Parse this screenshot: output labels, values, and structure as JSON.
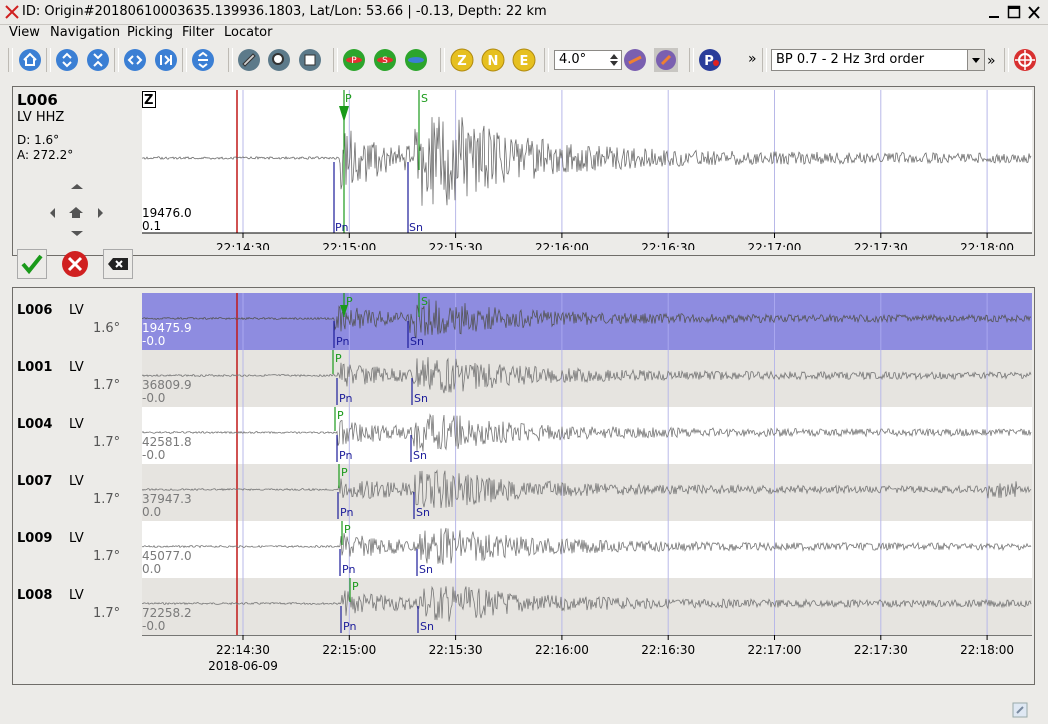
{
  "window": {
    "title": "ID: Origin#20180610003635.139936.1803, Lat/Lon: 53.66 | -0.13, Depth: 22 km"
  },
  "menu": [
    "View",
    "Navigation",
    "Picking",
    "Filter",
    "Locator"
  ],
  "toolbar": {
    "icons": [
      "home-icon",
      "scroll-up-down-icon",
      "scroll-center-icon",
      "prev-trace-icon",
      "next-trace-icon",
      "align-icon",
      "filter-icon",
      "zoom-icon",
      "save-icon",
      "pick-p-icon",
      "pick-s-icon",
      "pick-any-icon",
      "component-z",
      "component-n",
      "component-e"
    ],
    "components": [
      "Z",
      "N",
      "E"
    ],
    "distance_value": "4.0°",
    "more_label": "»",
    "filter_value": "BP 0.7 - 2 Hz  3rd order",
    "more_label_2": "»"
  },
  "current_trace": {
    "station": "L006",
    "network_channel": "LV  HHZ",
    "distance": "D:  1.6°",
    "azimuth": "A:  272.2°",
    "component": "Z",
    "amp_max": "19476.0",
    "amp_min": "0.1",
    "pick_p": "P",
    "pick_s": "S",
    "theo_pn": "Pn",
    "theo_sn": "Sn"
  },
  "time_axis": {
    "ticks": [
      "22:14:30",
      "22:15:00",
      "22:15:30",
      "22:16:00",
      "22:16:30",
      "22:17:00",
      "22:17:30",
      "22:18:00"
    ],
    "date": "2018-06-09"
  },
  "traces": [
    {
      "station": "L006",
      "network": "LV",
      "distance": "1.6°",
      "amp_max": "19475.9",
      "amp_min": "-0.0",
      "selected": true
    },
    {
      "station": "L001",
      "network": "LV",
      "distance": "1.7°",
      "amp_max": "36809.9",
      "amp_min": "-0.0",
      "selected": false
    },
    {
      "station": "L004",
      "network": "LV",
      "distance": "1.7°",
      "amp_max": "42581.8",
      "amp_min": "-0.0",
      "selected": false
    },
    {
      "station": "L007",
      "network": "LV",
      "distance": "1.7°",
      "amp_max": "37947.3",
      "amp_min": "0.0",
      "selected": false
    },
    {
      "station": "L009",
      "network": "LV",
      "distance": "1.7°",
      "amp_max": "45077.0",
      "amp_min": "0.0",
      "selected": false
    },
    {
      "station": "L008",
      "network": "LV",
      "distance": "1.7°",
      "amp_max": "72258.2",
      "amp_min": "-0.0",
      "selected": false
    }
  ],
  "pick_labels": {
    "p": "P",
    "s": "S",
    "pn": "Pn",
    "sn": "Sn"
  },
  "colors": {
    "selected_row": "#8e8ce0",
    "alt_row": "#e6e4e0",
    "trace": "#777777",
    "pick": "#1a9a1a",
    "theoretical": "#1c1c9a",
    "origin_line": "#c01818",
    "grid": "#b8b8e8"
  }
}
